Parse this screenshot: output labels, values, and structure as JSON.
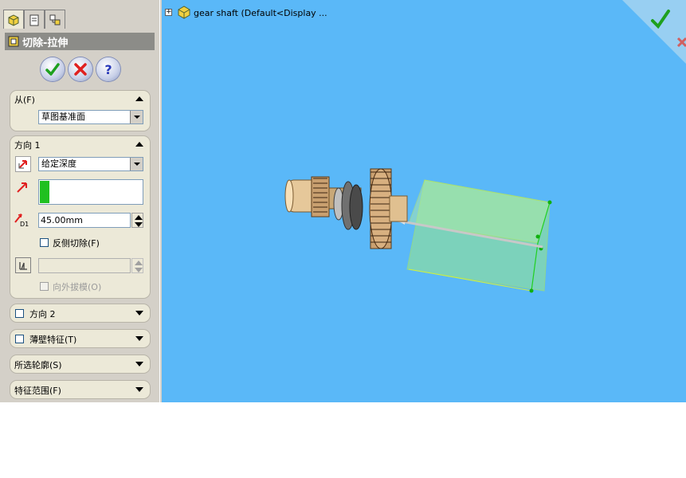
{
  "tree": {
    "expand": "+",
    "model_label": "gear shaft  (Default<Display ..."
  },
  "panel": {
    "title": "切除-拉伸",
    "from": {
      "header": "从(F)",
      "value": "草图基准面"
    },
    "direction1": {
      "header": "方向 1",
      "end_condition": "给定深度",
      "depth": "45.00mm",
      "depth_label": "D1",
      "flip_side": "反侧切除(F)",
      "draft_outward": "向外拔模(O)"
    },
    "direction2": {
      "header": "方向 2"
    },
    "thin_feature": {
      "header": "薄壁特征(T)"
    },
    "selected_contours": {
      "header": "所选轮廓(S)"
    },
    "feature_scope": {
      "header": "特征范围(F)"
    }
  },
  "colors": {
    "viewport_bg": "#5ab8f8",
    "panel_bg": "#d4d0c8",
    "group_bg": "#ece9d8",
    "title_bar": "#8c8c88",
    "preview_green": "#7ee07a"
  }
}
